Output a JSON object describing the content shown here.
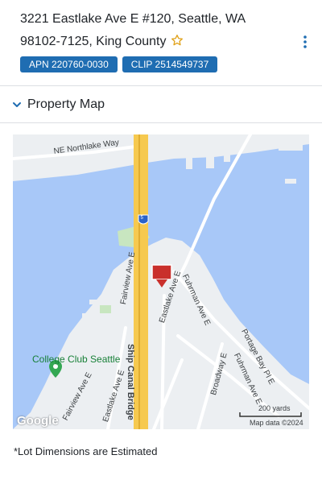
{
  "property": {
    "address_line": "3221 Eastlake Ave E #120, Seattle, WA 98102-7125, King County",
    "badges": [
      "APN 220760-0030",
      "CLIP 2514549737"
    ]
  },
  "icons": {
    "favorite": "star-outline-icon",
    "more": "vertical-ellipsis-icon",
    "collapse": "chevron-down-icon",
    "pin": "location-pin-icon"
  },
  "colors": {
    "accent": "#1f6db2",
    "water": "#a8c8f8",
    "freeway": "#f6c94f",
    "pin": "#c9302c"
  },
  "map_section": {
    "title": "Property Map",
    "streets": {
      "northlake": "NE Northlake Way",
      "fairview": "Fairview Ave E",
      "eastlake": "Eastlake Ave E",
      "fuhrman": "Fuhrman Ave E",
      "fuhrman2": "Fuhrman Ave E",
      "portage": "Portage Bay Pl E",
      "broadway": "Broadway E",
      "fairview_s": "Fairview Ave E",
      "eastlake_s": "Eastlake Ave E",
      "bridge": "Ship Canal Bridge"
    },
    "interstate": "5",
    "poi": "College Club Seattle",
    "scale": "200 yards",
    "attribution": "Map data ©2024",
    "provider": "Google"
  },
  "footnote": "*Lot Dimensions are Estimated"
}
